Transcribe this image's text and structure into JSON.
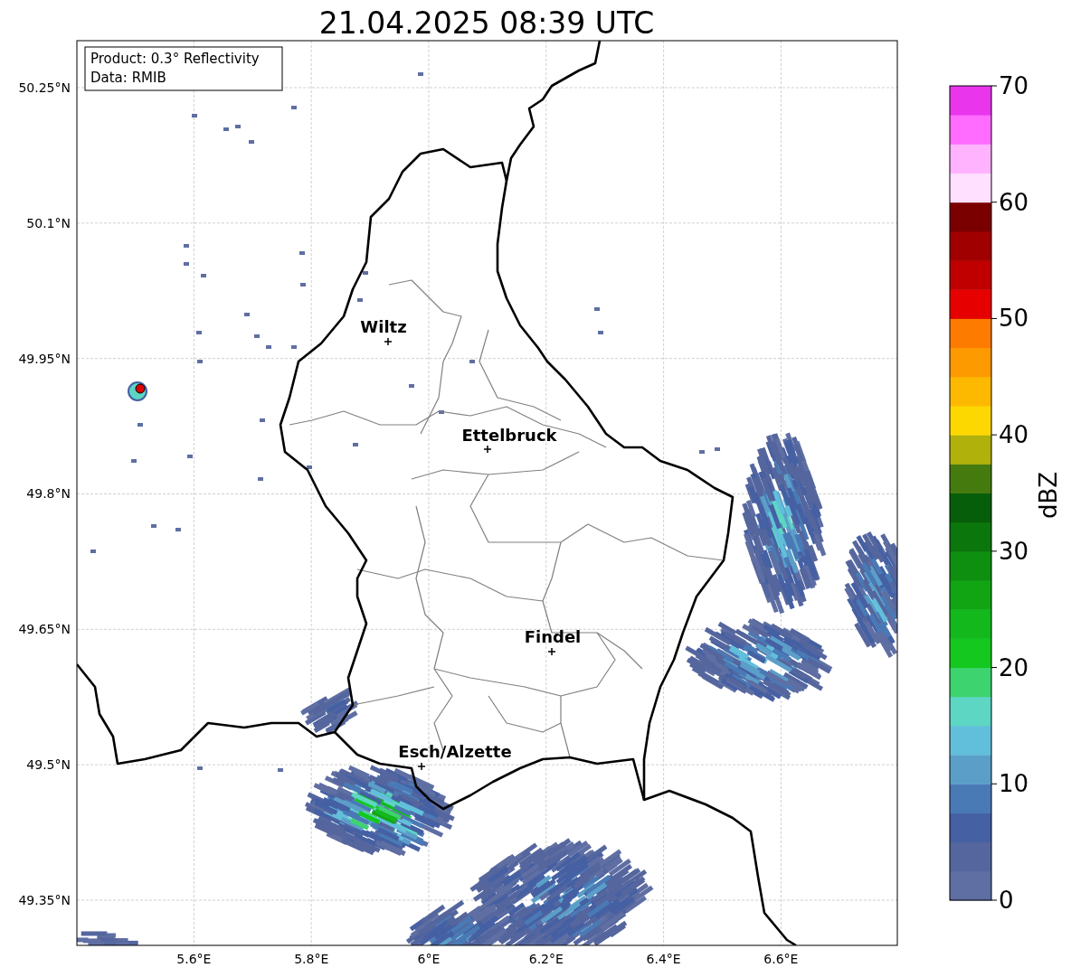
{
  "title": "21.04.2025 08:39 UTC",
  "info_box": {
    "lines": [
      "Product: 0.3° Reflectivity",
      "Data: RMIB"
    ]
  },
  "map": {
    "lat_ticks": [
      "50.25°N",
      "50.1°N",
      "49.95°N",
      "49.8°N",
      "49.65°N",
      "49.5°N",
      "49.35°N"
    ],
    "lon_ticks": [
      "5.6°E",
      "5.8°E",
      "6°E",
      "6.2°E",
      "6.4°E",
      "6.6°E"
    ],
    "cities": [
      {
        "name": "Wiltz"
      },
      {
        "name": "Ettelbruck"
      },
      {
        "name": "Findel"
      },
      {
        "name": "Esch/Alzette"
      }
    ]
  },
  "colorbar": {
    "label": "dBZ",
    "ticks": [
      "70",
      "60",
      "50",
      "40",
      "30",
      "20",
      "10",
      "0"
    ],
    "bins": [
      {
        "color": "#5f6fa3"
      },
      {
        "color": "#55669e"
      },
      {
        "color": "#4560a3"
      },
      {
        "color": "#4a7ab5"
      },
      {
        "color": "#5b9fc9"
      },
      {
        "color": "#62bfdc"
      },
      {
        "color": "#5dd6c4"
      },
      {
        "color": "#3dd36e"
      },
      {
        "color": "#14c81f"
      },
      {
        "color": "#13b81c"
      },
      {
        "color": "#11a514"
      },
      {
        "color": "#0e8f10"
      },
      {
        "color": "#0b760c"
      },
      {
        "color": "#075e0a"
      },
      {
        "color": "#457a0f"
      },
      {
        "color": "#b0b10a"
      },
      {
        "color": "#fdd700"
      },
      {
        "color": "#fdb900"
      },
      {
        "color": "#fd9a00"
      },
      {
        "color": "#fd7c00"
      },
      {
        "color": "#e60000"
      },
      {
        "color": "#c00000"
      },
      {
        "color": "#a00000"
      },
      {
        "color": "#7a0000"
      },
      {
        "color": "#ffe0ff"
      },
      {
        "color": "#ffb3ff"
      },
      {
        "color": "#ff6cff"
      },
      {
        "color": "#e936ed"
      }
    ]
  }
}
